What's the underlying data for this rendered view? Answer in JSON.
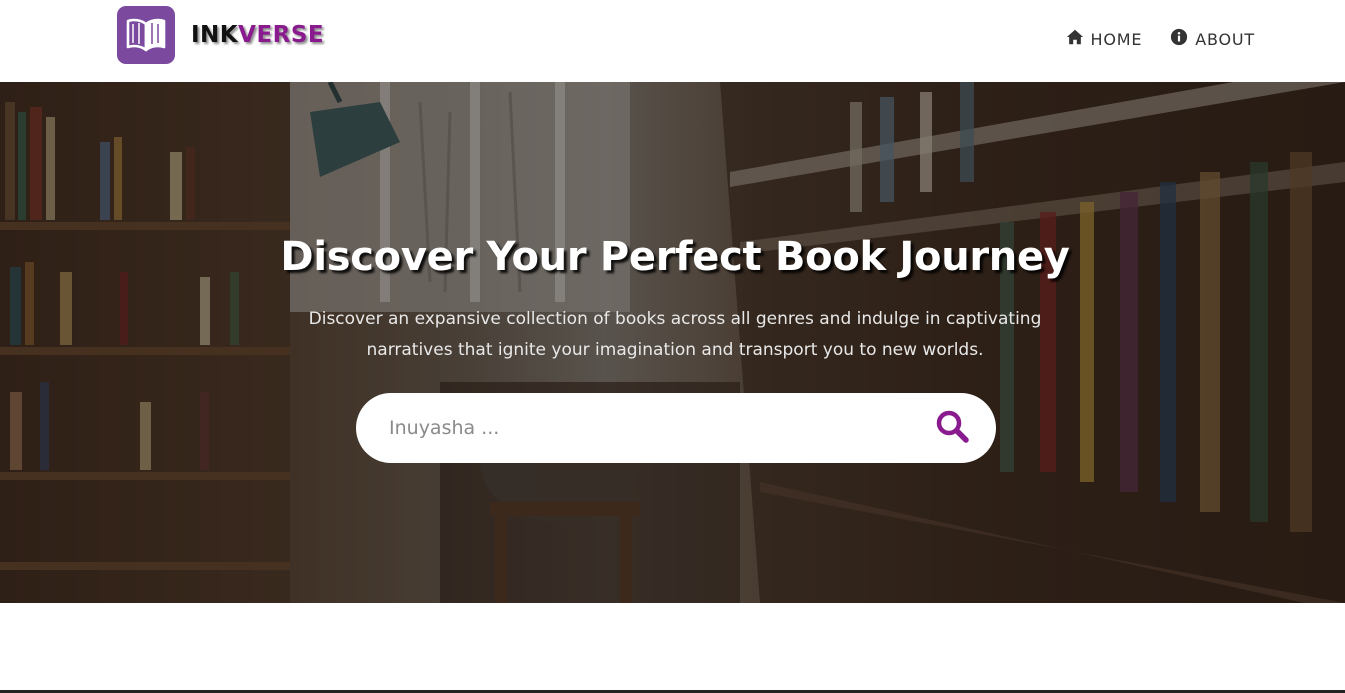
{
  "brand": {
    "name_part1": "INK",
    "name_part2": "VERSE",
    "logo_icon": "open-book-icon",
    "accent_color": "#8a1b8f",
    "logo_bg_color": "#7b4a9e"
  },
  "nav": {
    "items": [
      {
        "label": "HOME",
        "icon": "home-icon"
      },
      {
        "label": "ABOUT",
        "icon": "info-circle-icon"
      }
    ]
  },
  "hero": {
    "title": "Discover Your Perfect Book Journey",
    "description": "Discover an expansive collection of books across all genres and indulge in captivating narratives that ignite your imagination and transport you to new worlds."
  },
  "search": {
    "placeholder": "Inuyasha ...",
    "value": "",
    "icon": "search-icon",
    "icon_color": "#8a1b8f"
  }
}
